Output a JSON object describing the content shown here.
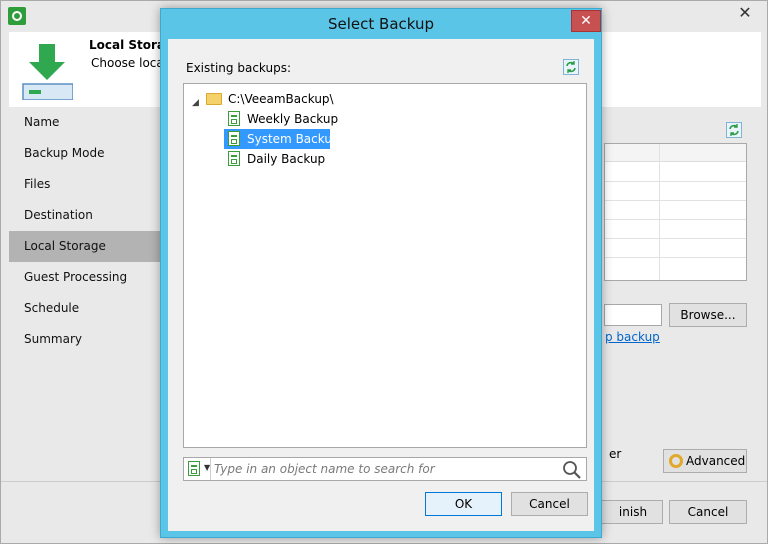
{
  "background_window": {
    "header": {
      "title": "Local Storage",
      "description": "Choose locall"
    },
    "nav": {
      "items": [
        "Name",
        "Backup Mode",
        "Files",
        "Destination",
        "Local Storage",
        "Guest Processing",
        "Schedule",
        "Summary"
      ],
      "active": "Local Storage"
    },
    "content": {
      "browse_label": "Browse...",
      "map_link": "p backup",
      "er_text": "er",
      "advanced_label": "Advanced"
    },
    "footer": {
      "finish_label": "inish",
      "cancel_label": "Cancel"
    },
    "close_glyph": "✕"
  },
  "dialog": {
    "title": "Select Backup",
    "close_glyph": "✕",
    "existing_label": "Existing backups:",
    "tree": {
      "root": "C:\\VeeamBackup\\",
      "children": [
        "Weekly Backup",
        "System Backup",
        "Daily Backup"
      ],
      "selected": "System Backup"
    },
    "search": {
      "placeholder": "Type in an object name to search for",
      "value": ""
    },
    "ok_label": "OK",
    "cancel_label": "Cancel"
  },
  "colors": {
    "dialog_frame": "#5bc5e8",
    "selection": "#3399ff",
    "close_button": "#c75050",
    "veeam_green": "#2f9e3a",
    "link": "#0066cc"
  },
  "icons": {
    "app": "gear-icon",
    "header": "download-arrow-icon",
    "refresh": "refresh-icon",
    "folder": "folder-icon",
    "backup": "backup-job-icon",
    "search": "magnifier-icon",
    "advanced": "gear-icon"
  }
}
